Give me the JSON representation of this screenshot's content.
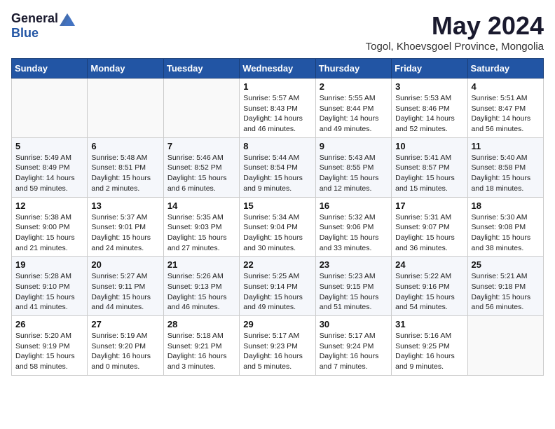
{
  "logo": {
    "general": "General",
    "blue": "Blue"
  },
  "header": {
    "month_title": "May 2024",
    "subtitle": "Togol, Khoevsgoel Province, Mongolia"
  },
  "weekdays": [
    "Sunday",
    "Monday",
    "Tuesday",
    "Wednesday",
    "Thursday",
    "Friday",
    "Saturday"
  ],
  "weeks": [
    [
      {
        "day": "",
        "sunrise": "",
        "sunset": "",
        "daylight": ""
      },
      {
        "day": "",
        "sunrise": "",
        "sunset": "",
        "daylight": ""
      },
      {
        "day": "",
        "sunrise": "",
        "sunset": "",
        "daylight": ""
      },
      {
        "day": "1",
        "sunrise": "Sunrise: 5:57 AM",
        "sunset": "Sunset: 8:43 PM",
        "daylight": "Daylight: 14 hours and 46 minutes."
      },
      {
        "day": "2",
        "sunrise": "Sunrise: 5:55 AM",
        "sunset": "Sunset: 8:44 PM",
        "daylight": "Daylight: 14 hours and 49 minutes."
      },
      {
        "day": "3",
        "sunrise": "Sunrise: 5:53 AM",
        "sunset": "Sunset: 8:46 PM",
        "daylight": "Daylight: 14 hours and 52 minutes."
      },
      {
        "day": "4",
        "sunrise": "Sunrise: 5:51 AM",
        "sunset": "Sunset: 8:47 PM",
        "daylight": "Daylight: 14 hours and 56 minutes."
      }
    ],
    [
      {
        "day": "5",
        "sunrise": "Sunrise: 5:49 AM",
        "sunset": "Sunset: 8:49 PM",
        "daylight": "Daylight: 14 hours and 59 minutes."
      },
      {
        "day": "6",
        "sunrise": "Sunrise: 5:48 AM",
        "sunset": "Sunset: 8:51 PM",
        "daylight": "Daylight: 15 hours and 2 minutes."
      },
      {
        "day": "7",
        "sunrise": "Sunrise: 5:46 AM",
        "sunset": "Sunset: 8:52 PM",
        "daylight": "Daylight: 15 hours and 6 minutes."
      },
      {
        "day": "8",
        "sunrise": "Sunrise: 5:44 AM",
        "sunset": "Sunset: 8:54 PM",
        "daylight": "Daylight: 15 hours and 9 minutes."
      },
      {
        "day": "9",
        "sunrise": "Sunrise: 5:43 AM",
        "sunset": "Sunset: 8:55 PM",
        "daylight": "Daylight: 15 hours and 12 minutes."
      },
      {
        "day": "10",
        "sunrise": "Sunrise: 5:41 AM",
        "sunset": "Sunset: 8:57 PM",
        "daylight": "Daylight: 15 hours and 15 minutes."
      },
      {
        "day": "11",
        "sunrise": "Sunrise: 5:40 AM",
        "sunset": "Sunset: 8:58 PM",
        "daylight": "Daylight: 15 hours and 18 minutes."
      }
    ],
    [
      {
        "day": "12",
        "sunrise": "Sunrise: 5:38 AM",
        "sunset": "Sunset: 9:00 PM",
        "daylight": "Daylight: 15 hours and 21 minutes."
      },
      {
        "day": "13",
        "sunrise": "Sunrise: 5:37 AM",
        "sunset": "Sunset: 9:01 PM",
        "daylight": "Daylight: 15 hours and 24 minutes."
      },
      {
        "day": "14",
        "sunrise": "Sunrise: 5:35 AM",
        "sunset": "Sunset: 9:03 PM",
        "daylight": "Daylight: 15 hours and 27 minutes."
      },
      {
        "day": "15",
        "sunrise": "Sunrise: 5:34 AM",
        "sunset": "Sunset: 9:04 PM",
        "daylight": "Daylight: 15 hours and 30 minutes."
      },
      {
        "day": "16",
        "sunrise": "Sunrise: 5:32 AM",
        "sunset": "Sunset: 9:06 PM",
        "daylight": "Daylight: 15 hours and 33 minutes."
      },
      {
        "day": "17",
        "sunrise": "Sunrise: 5:31 AM",
        "sunset": "Sunset: 9:07 PM",
        "daylight": "Daylight: 15 hours and 36 minutes."
      },
      {
        "day": "18",
        "sunrise": "Sunrise: 5:30 AM",
        "sunset": "Sunset: 9:08 PM",
        "daylight": "Daylight: 15 hours and 38 minutes."
      }
    ],
    [
      {
        "day": "19",
        "sunrise": "Sunrise: 5:28 AM",
        "sunset": "Sunset: 9:10 PM",
        "daylight": "Daylight: 15 hours and 41 minutes."
      },
      {
        "day": "20",
        "sunrise": "Sunrise: 5:27 AM",
        "sunset": "Sunset: 9:11 PM",
        "daylight": "Daylight: 15 hours and 44 minutes."
      },
      {
        "day": "21",
        "sunrise": "Sunrise: 5:26 AM",
        "sunset": "Sunset: 9:13 PM",
        "daylight": "Daylight: 15 hours and 46 minutes."
      },
      {
        "day": "22",
        "sunrise": "Sunrise: 5:25 AM",
        "sunset": "Sunset: 9:14 PM",
        "daylight": "Daylight: 15 hours and 49 minutes."
      },
      {
        "day": "23",
        "sunrise": "Sunrise: 5:23 AM",
        "sunset": "Sunset: 9:15 PM",
        "daylight": "Daylight: 15 hours and 51 minutes."
      },
      {
        "day": "24",
        "sunrise": "Sunrise: 5:22 AM",
        "sunset": "Sunset: 9:16 PM",
        "daylight": "Daylight: 15 hours and 54 minutes."
      },
      {
        "day": "25",
        "sunrise": "Sunrise: 5:21 AM",
        "sunset": "Sunset: 9:18 PM",
        "daylight": "Daylight: 15 hours and 56 minutes."
      }
    ],
    [
      {
        "day": "26",
        "sunrise": "Sunrise: 5:20 AM",
        "sunset": "Sunset: 9:19 PM",
        "daylight": "Daylight: 15 hours and 58 minutes."
      },
      {
        "day": "27",
        "sunrise": "Sunrise: 5:19 AM",
        "sunset": "Sunset: 9:20 PM",
        "daylight": "Daylight: 16 hours and 0 minutes."
      },
      {
        "day": "28",
        "sunrise": "Sunrise: 5:18 AM",
        "sunset": "Sunset: 9:21 PM",
        "daylight": "Daylight: 16 hours and 3 minutes."
      },
      {
        "day": "29",
        "sunrise": "Sunrise: 5:17 AM",
        "sunset": "Sunset: 9:23 PM",
        "daylight": "Daylight: 16 hours and 5 minutes."
      },
      {
        "day": "30",
        "sunrise": "Sunrise: 5:17 AM",
        "sunset": "Sunset: 9:24 PM",
        "daylight": "Daylight: 16 hours and 7 minutes."
      },
      {
        "day": "31",
        "sunrise": "Sunrise: 5:16 AM",
        "sunset": "Sunset: 9:25 PM",
        "daylight": "Daylight: 16 hours and 9 minutes."
      },
      {
        "day": "",
        "sunrise": "",
        "sunset": "",
        "daylight": ""
      }
    ]
  ]
}
